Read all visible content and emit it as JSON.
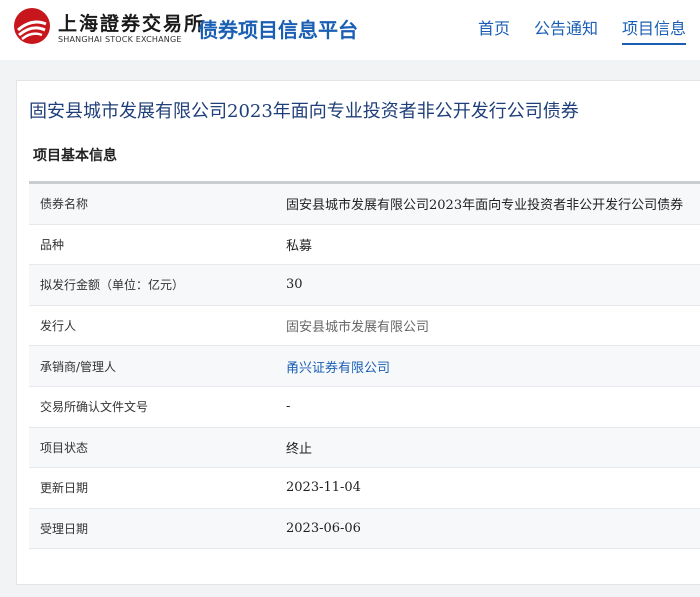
{
  "header": {
    "logo_cn": "上海證券交易所",
    "logo_en": "SHANGHAI STOCK EXCHANGE",
    "platform_title": "债券项目信息平台",
    "nav": [
      {
        "label": "首页",
        "active": false
      },
      {
        "label": "公告通知",
        "active": false
      },
      {
        "label": "项目信息",
        "active": true
      }
    ]
  },
  "project": {
    "title": "固安县城市发展有限公司2023年面向专业投资者非公开发行公司债券",
    "section_title": "项目基本信息",
    "rows": [
      {
        "label": "债券名称",
        "value": "固安县城市发展有限公司2023年面向专业投资者非公开发行公司债券",
        "style": "normal"
      },
      {
        "label": "品种",
        "value": "私募",
        "style": "normal"
      },
      {
        "label": "拟发行金额（单位：亿元）",
        "value": "30",
        "style": "normal"
      },
      {
        "label": "发行人",
        "value": "固安县城市发展有限公司",
        "style": "muted"
      },
      {
        "label": "承销商/管理人",
        "value": "甬兴证券有限公司",
        "style": "link"
      },
      {
        "label": "交易所确认文件文号",
        "value": "-",
        "style": "normal"
      },
      {
        "label": "项目状态",
        "value": "终止",
        "style": "normal"
      },
      {
        "label": "更新日期",
        "value": "2023-11-04",
        "style": "normal"
      },
      {
        "label": "受理日期",
        "value": "2023-06-06",
        "style": "normal"
      }
    ]
  },
  "colors": {
    "brand_blue": "#1a5fb4",
    "title_navy": "#1f3f7a",
    "logo_red": "#c8161d"
  }
}
